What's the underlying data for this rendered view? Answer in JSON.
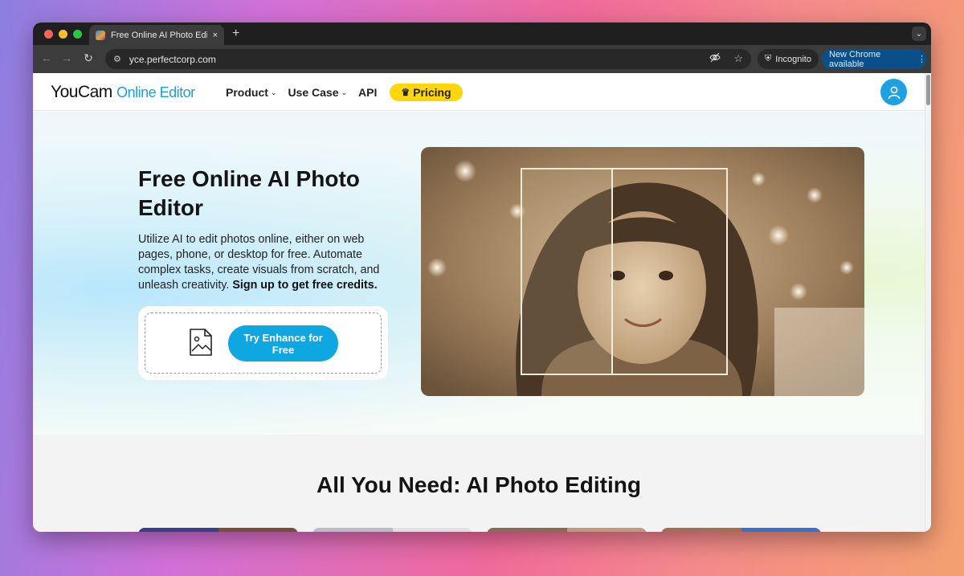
{
  "browser": {
    "tab_title": "Free Online AI Photo Editor, I",
    "tab_close": "×",
    "new_tab": "+",
    "tab_menu": "⌄",
    "url": "yce.perfectcorp.com",
    "incognito_label": "Incognito",
    "update_label": "New Chrome available"
  },
  "header": {
    "logo_main": "YouCam",
    "logo_accent": "Online Editor",
    "nav": [
      {
        "label": "Product"
      },
      {
        "label": "Use Case"
      },
      {
        "label": "API"
      }
    ],
    "pricing_label": "Pricing",
    "icons": {
      "avatar": "user-icon",
      "pricing": "crown-icon"
    }
  },
  "hero": {
    "title": "Free Online AI Photo Editor",
    "description": "Utilize AI to edit photos online, either on web pages, phone, or desktop for free. Automate complex tasks, create visuals from scratch, and unleash creativity.",
    "description_bold": "Sign up to get free credits.",
    "cta_label": "Try Enhance for Free",
    "upload_icon": "image-file-icon"
  },
  "section": {
    "title": "All You Need: AI Photo Editing"
  },
  "colors": {
    "accent_blue": "#0fa7e2",
    "pricing_yellow": "#ffd60a",
    "update_button": "#0b4f8a"
  }
}
